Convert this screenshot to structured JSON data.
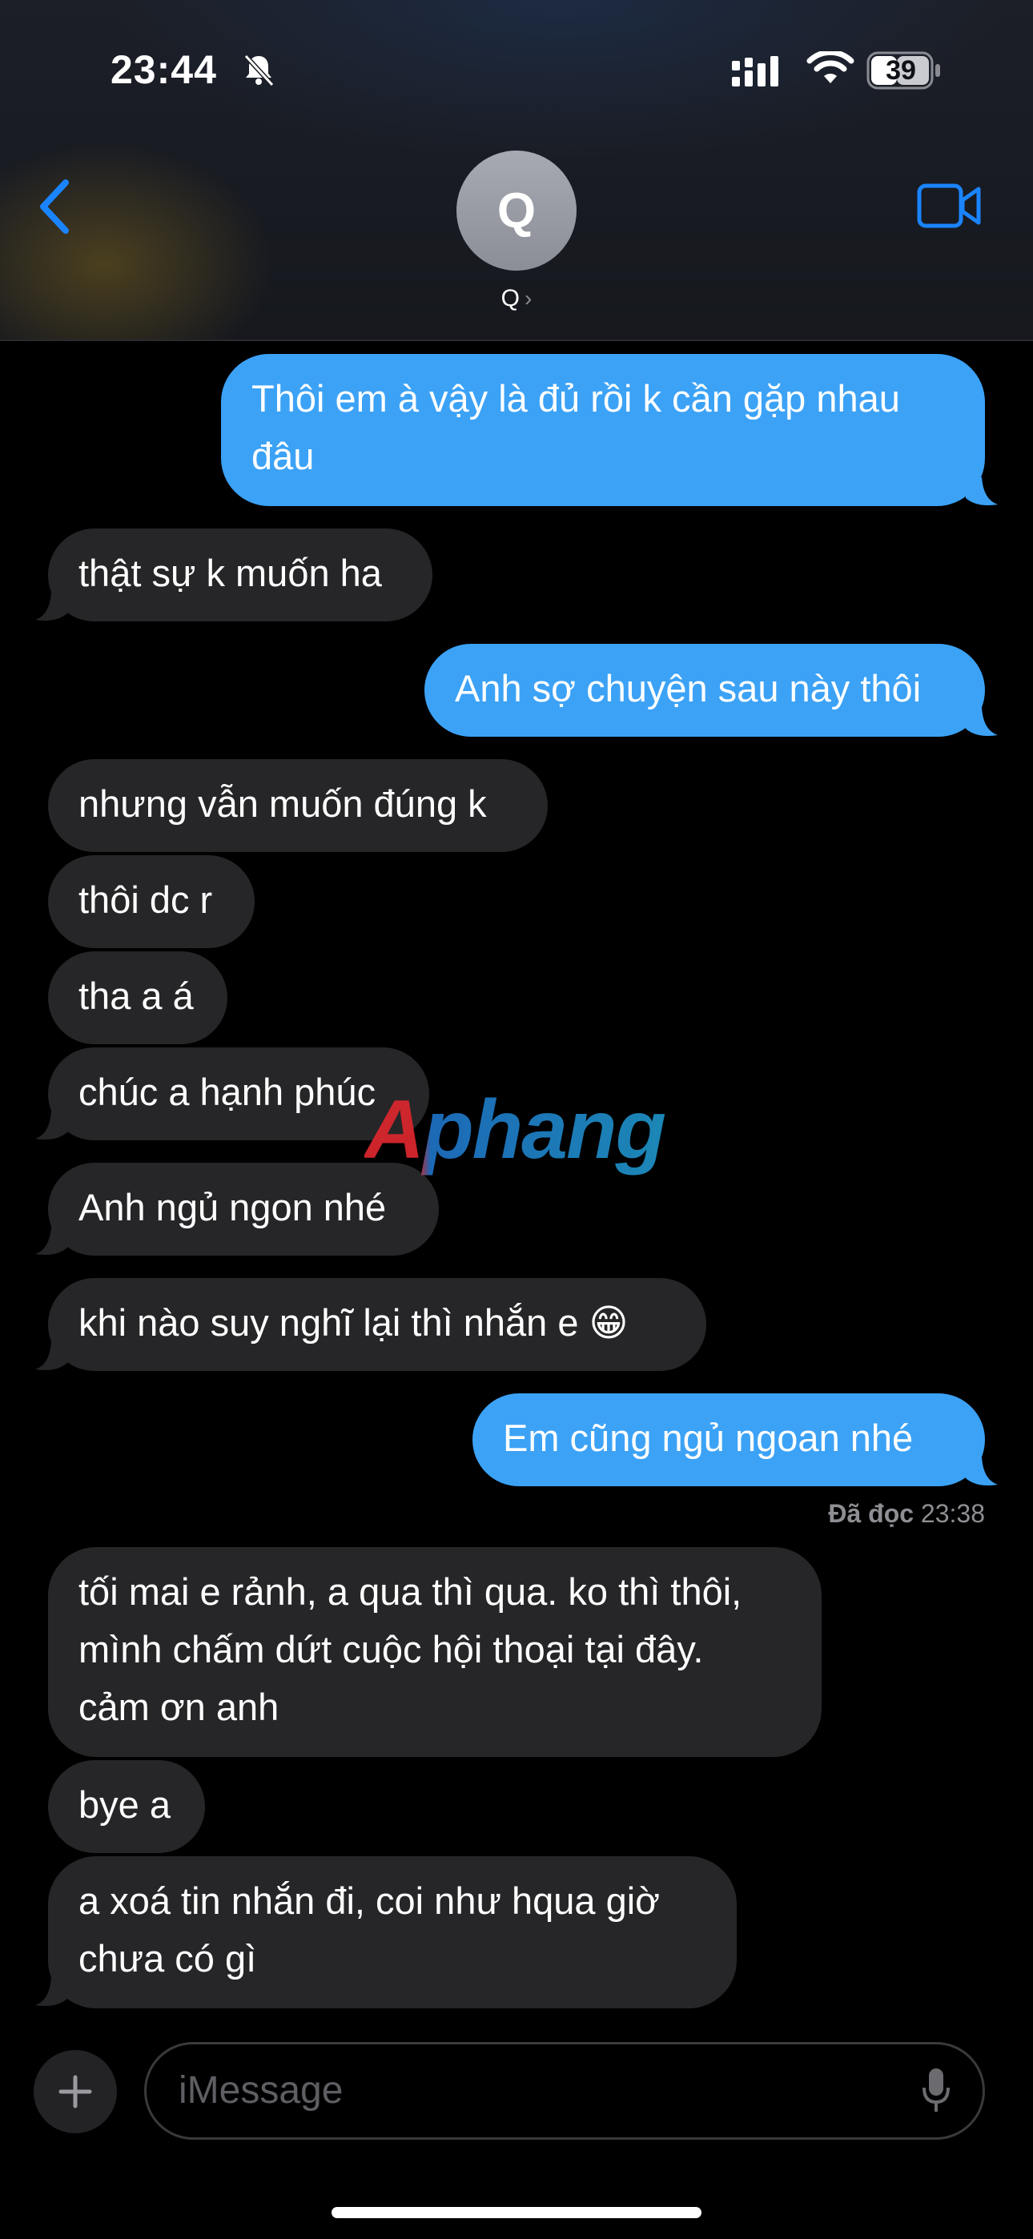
{
  "status_bar": {
    "time": "23:44",
    "battery": "39"
  },
  "header": {
    "avatar_initial": "Q",
    "contact_name": "Q",
    "chevron": "›"
  },
  "messages": [
    {
      "dir": "out",
      "text": "Thôi em à vậy là đủ rồi k cần gặp nhau\nđâu"
    },
    {
      "dir": "in",
      "text": "thật sự k muốn ha"
    },
    {
      "dir": "out",
      "text": "Anh sợ chuyện sau này thôi"
    },
    {
      "dir": "in",
      "text": "nhưng vẫn muốn đúng k"
    },
    {
      "dir": "in",
      "text": "thôi dc r"
    },
    {
      "dir": "in",
      "text": "tha a á"
    },
    {
      "dir": "in",
      "text": "chúc a hạnh phúc"
    },
    {
      "dir": "in",
      "text": "Anh ngủ ngon nhé"
    },
    {
      "dir": "in",
      "text": "khi nào suy nghĩ lại thì nhắn e 😁"
    },
    {
      "dir": "out",
      "text": "Em cũng ngủ ngoan nhé"
    },
    {
      "dir": "in",
      "text": "tối mai e rảnh, a qua thì qua. ko thì thôi,\nmình chấm dứt cuộc hội thoại tại đây.\ncảm ơn anh"
    },
    {
      "dir": "in",
      "text": "bye a"
    },
    {
      "dir": "in",
      "text": "a xoá tin nhắn đi, coi như hqua giờ\nchưa có gì"
    }
  ],
  "read_receipt": {
    "label": "Đã đọc",
    "time": "23:38"
  },
  "watermark": "Aphang",
  "composer": {
    "placeholder": "iMessage"
  },
  "colors": {
    "outgoing": "#3ca2f6",
    "incoming": "#262628",
    "accent": "#1a84ff"
  },
  "icons": [
    "bell-off-icon",
    "signal-icon",
    "wifi-icon",
    "battery-icon",
    "back-chevron-icon",
    "video-call-icon",
    "plus-icon",
    "mic-icon"
  ]
}
